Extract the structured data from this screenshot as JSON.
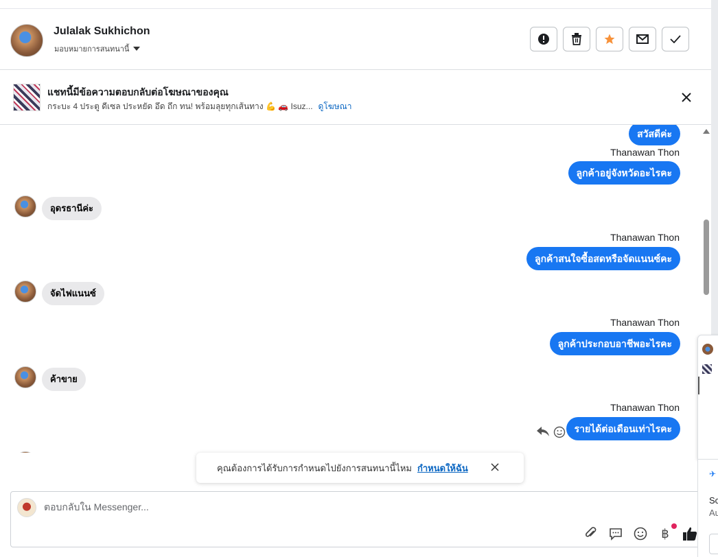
{
  "header": {
    "contact_name": "Julalak Sukhichon",
    "assign_label": "มอบหมายการสนทนานี้",
    "actions": [
      {
        "name": "spam-button",
        "icon": "exclamation-icon"
      },
      {
        "name": "delete-button",
        "icon": "trash-icon"
      },
      {
        "name": "star-button",
        "icon": "star-icon",
        "color": "#f7923b"
      },
      {
        "name": "mark-unread-button",
        "icon": "envelope-icon"
      },
      {
        "name": "mark-done-button",
        "icon": "check-icon"
      }
    ]
  },
  "ad_banner": {
    "title": "แชทนี้มีข้อความตอบกลับต่อโฆษณาของคุณ",
    "subtitle": "กระบะ 4 ประตู ดีเซล ประหยัด อึด ถึก ทน! พร้อมลุยทุกเส้นทาง 💪 🚗 Isuz...",
    "link_label": "ดูโฆษณา"
  },
  "messages": [
    {
      "dir": "out",
      "text": "สวัสดีค่ะ"
    },
    {
      "dir": "out",
      "sender": "Thanawan Thon",
      "text": "ลูกค้าอยู่จังหวัดอะไรคะ"
    },
    {
      "dir": "in",
      "text": "อุดรธานีค่ะ"
    },
    {
      "dir": "out",
      "sender": "Thanawan Thon",
      "text": "ลูกค้าสนใจซื้อสดหรือจัดแนนซ์คะ"
    },
    {
      "dir": "in",
      "text": "จัดไฟแนนซ์"
    },
    {
      "dir": "out",
      "sender": "Thanawan Thon",
      "text": "ลูกค้าประกอบอาชีพอะไรคะ"
    },
    {
      "dir": "in",
      "text": "ค้าขาย"
    },
    {
      "dir": "out",
      "sender": "Thanawan Thon",
      "text": "รายได้ต่อเดือนเท่าไรคะ"
    }
  ],
  "toast": {
    "text": "คุณต้องการได้รับการกำหนดไปยังการสนทนานี้ไหม",
    "link": "กำหนดให้ฉัน"
  },
  "composer": {
    "placeholder": "ตอบกลับใน Messenger...",
    "tools": [
      "paperclip-icon",
      "chat-bubble-icon",
      "emoji-icon",
      "baht-icon",
      "thumbs-up-icon"
    ],
    "baht_symbol": "฿"
  },
  "side_panel": {
    "line1": "Sc",
    "line2": "Au"
  },
  "colors": {
    "accent": "#1877f2",
    "star": "#f7923b",
    "notification_dot": "#e0245e"
  }
}
